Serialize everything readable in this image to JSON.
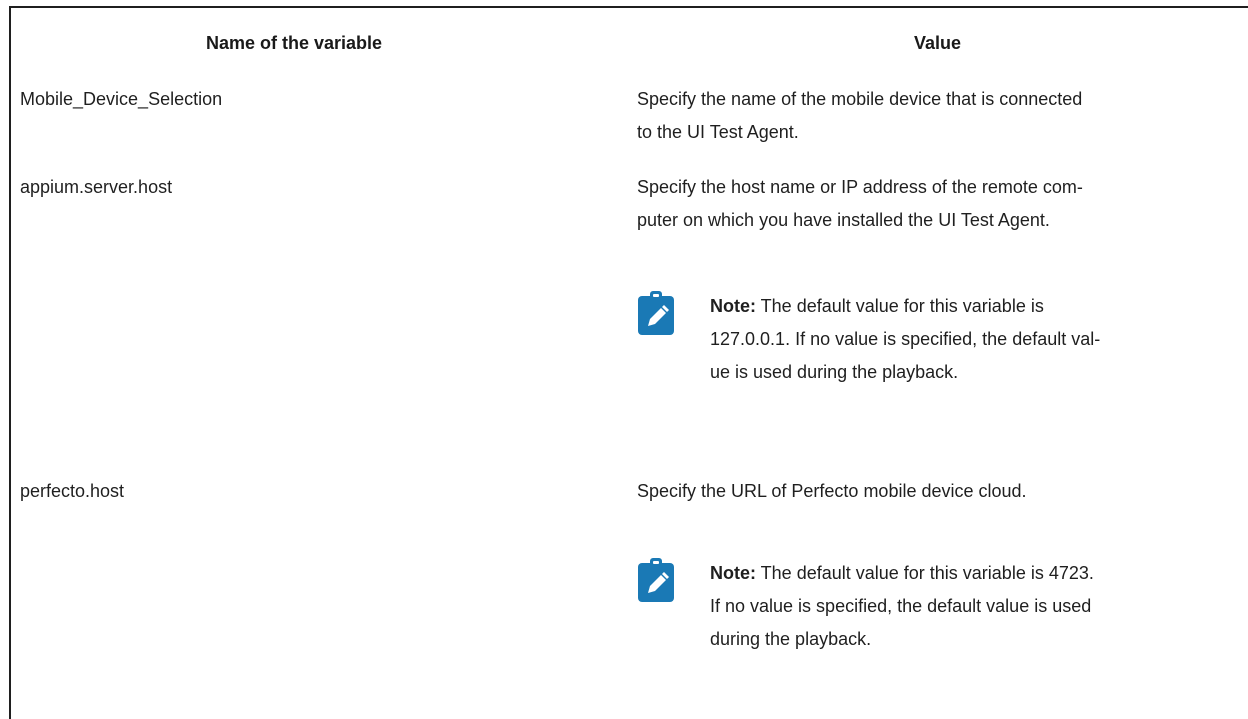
{
  "table": {
    "headers": {
      "name": "Name of the variable",
      "value": "Value"
    },
    "rows": [
      {
        "name": "Mobile_Device_Selection",
        "value_lines": [
          "Specify the name of the mobile device that is connected",
          "to the UI Test Agent."
        ]
      },
      {
        "name": "appium.server.host",
        "value_lines": [
          "Specify the host name or IP address of the remote com-",
          "puter on which you have installed the UI Test Agent."
        ],
        "note": {
          "label": "Note:",
          "lines": [
            " The default value for this variable is",
            "127.0.0.1. If no value is specified, the default val-",
            "ue is used during the playback."
          ]
        }
      },
      {
        "name": "perfecto.host",
        "value_lines": [
          "Specify the URL of Perfecto mobile device cloud."
        ],
        "note": {
          "label": "Note:",
          "lines": [
            " The default value for this variable is 4723.",
            "If no value is specified, the default value is used",
            "during the playback."
          ]
        }
      }
    ]
  },
  "colors": {
    "note_icon_bg": "#1a79b5",
    "note_icon_fg": "#ffffff",
    "text": "#1f1f1f"
  },
  "icons": {
    "note": "pencil-clipboard-icon"
  }
}
